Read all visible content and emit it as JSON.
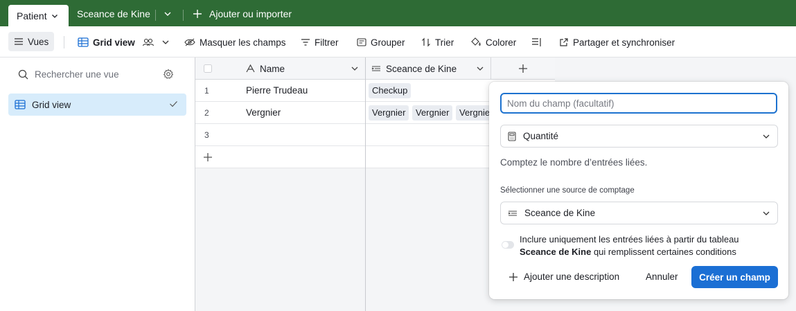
{
  "tabs": {
    "active": "Patient",
    "second": "Sceance de Kine",
    "add_import": "Ajouter ou importer"
  },
  "toolbar": {
    "views": "Vues",
    "grid_view": "Grid view",
    "hide_fields": "Masquer les champs",
    "filter": "Filtrer",
    "group": "Grouper",
    "sort": "Trier",
    "color": "Colorer",
    "share": "Partager et synchroniser"
  },
  "sidebar": {
    "search_placeholder": "Rechercher une vue",
    "items": [
      {
        "label": "Grid view"
      }
    ]
  },
  "grid": {
    "columns": [
      "Name",
      "Sceance de Kine"
    ],
    "rows": [
      {
        "num": "1",
        "name": "Pierre Trudeau",
        "links": [
          "Checkup"
        ]
      },
      {
        "num": "2",
        "name": "Vergnier",
        "links": [
          "Vergnier",
          "Vergnier",
          "Vergnie"
        ]
      },
      {
        "num": "3",
        "name": "",
        "links": []
      }
    ]
  },
  "popup": {
    "field_placeholder": "Nom du champ (facultatif)",
    "type": "Quantité",
    "hint": "Comptez le nombre d’entrées liées.",
    "source_label": "Sélectionner une source de comptage",
    "source": "Sceance de Kine",
    "include_text_1": "Inclure uniquement les entrées liées à partir du tableau",
    "include_table": "Sceance de Kine",
    "include_text_2": "qui remplissent certaines conditions",
    "add_description": "Ajouter une description",
    "cancel": "Annuler",
    "create": "Créer un champ"
  },
  "colors": {
    "header_green": "#2e6b35",
    "accent_blue": "#1b6fd4",
    "selected_view": "#d7ecfb"
  }
}
